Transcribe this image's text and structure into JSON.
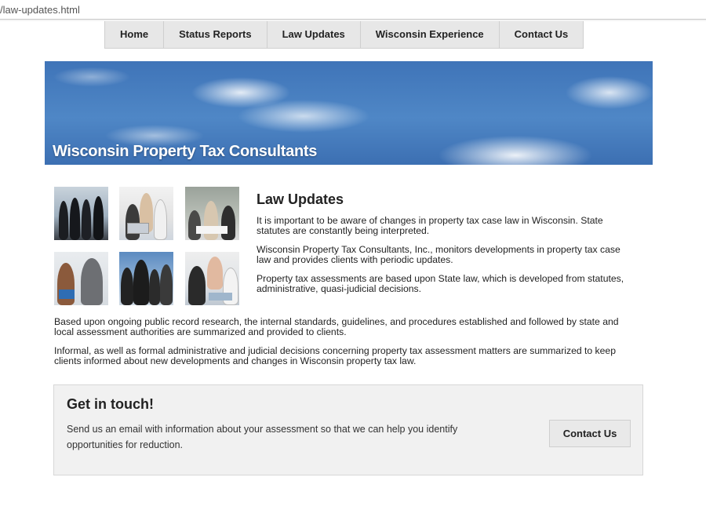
{
  "browser": {
    "url_fragment": "/law-updates.html"
  },
  "nav": {
    "items": [
      {
        "label": "Home"
      },
      {
        "label": "Status Reports"
      },
      {
        "label": "Law Updates"
      },
      {
        "label": "Wisconsin Experience"
      },
      {
        "label": "Contact Us"
      }
    ]
  },
  "banner": {
    "title": "Wisconsin Property Tax Consultants"
  },
  "photos": [
    {
      "icon": "people-silhouette-photo"
    },
    {
      "icon": "team-meeting-photo"
    },
    {
      "icon": "office-group-photo"
    },
    {
      "icon": "business-handshake-photo"
    },
    {
      "icon": "business-team-photo"
    },
    {
      "icon": "colleagues-laptop-photo"
    }
  ],
  "main": {
    "title": "Law Updates",
    "paragraphs": [
      "It is important to be aware of changes in property tax case law in Wisconsin. State statutes are constantly being interpreted.",
      "Wisconsin Property Tax Consultants, Inc., monitors developments in property tax case law and provides clients with periodic updates.",
      "Property tax assessments are based upon State law, which is developed from statutes, administrative, quasi-judicial decisions.",
      "Based upon ongoing public record research, the internal standards, guidelines, and procedures established and followed by state and local assessment authorities are summarized and provided to clients.",
      "Informal, as well as formal administrative and judicial decisions concerning property tax assessment matters are summarized to keep clients informed about new developments and changes in Wisconsin property tax law."
    ]
  },
  "cta": {
    "title": "Get in touch!",
    "text": "Send us an email with information about your assessment so that we can help you identify opportunities for reduction.",
    "button_label": "Contact Us"
  },
  "colors": {
    "banner_sky": "#4a80c2",
    "nav_bg": "#e7e7e7",
    "cta_bg": "#f1f1f1"
  }
}
